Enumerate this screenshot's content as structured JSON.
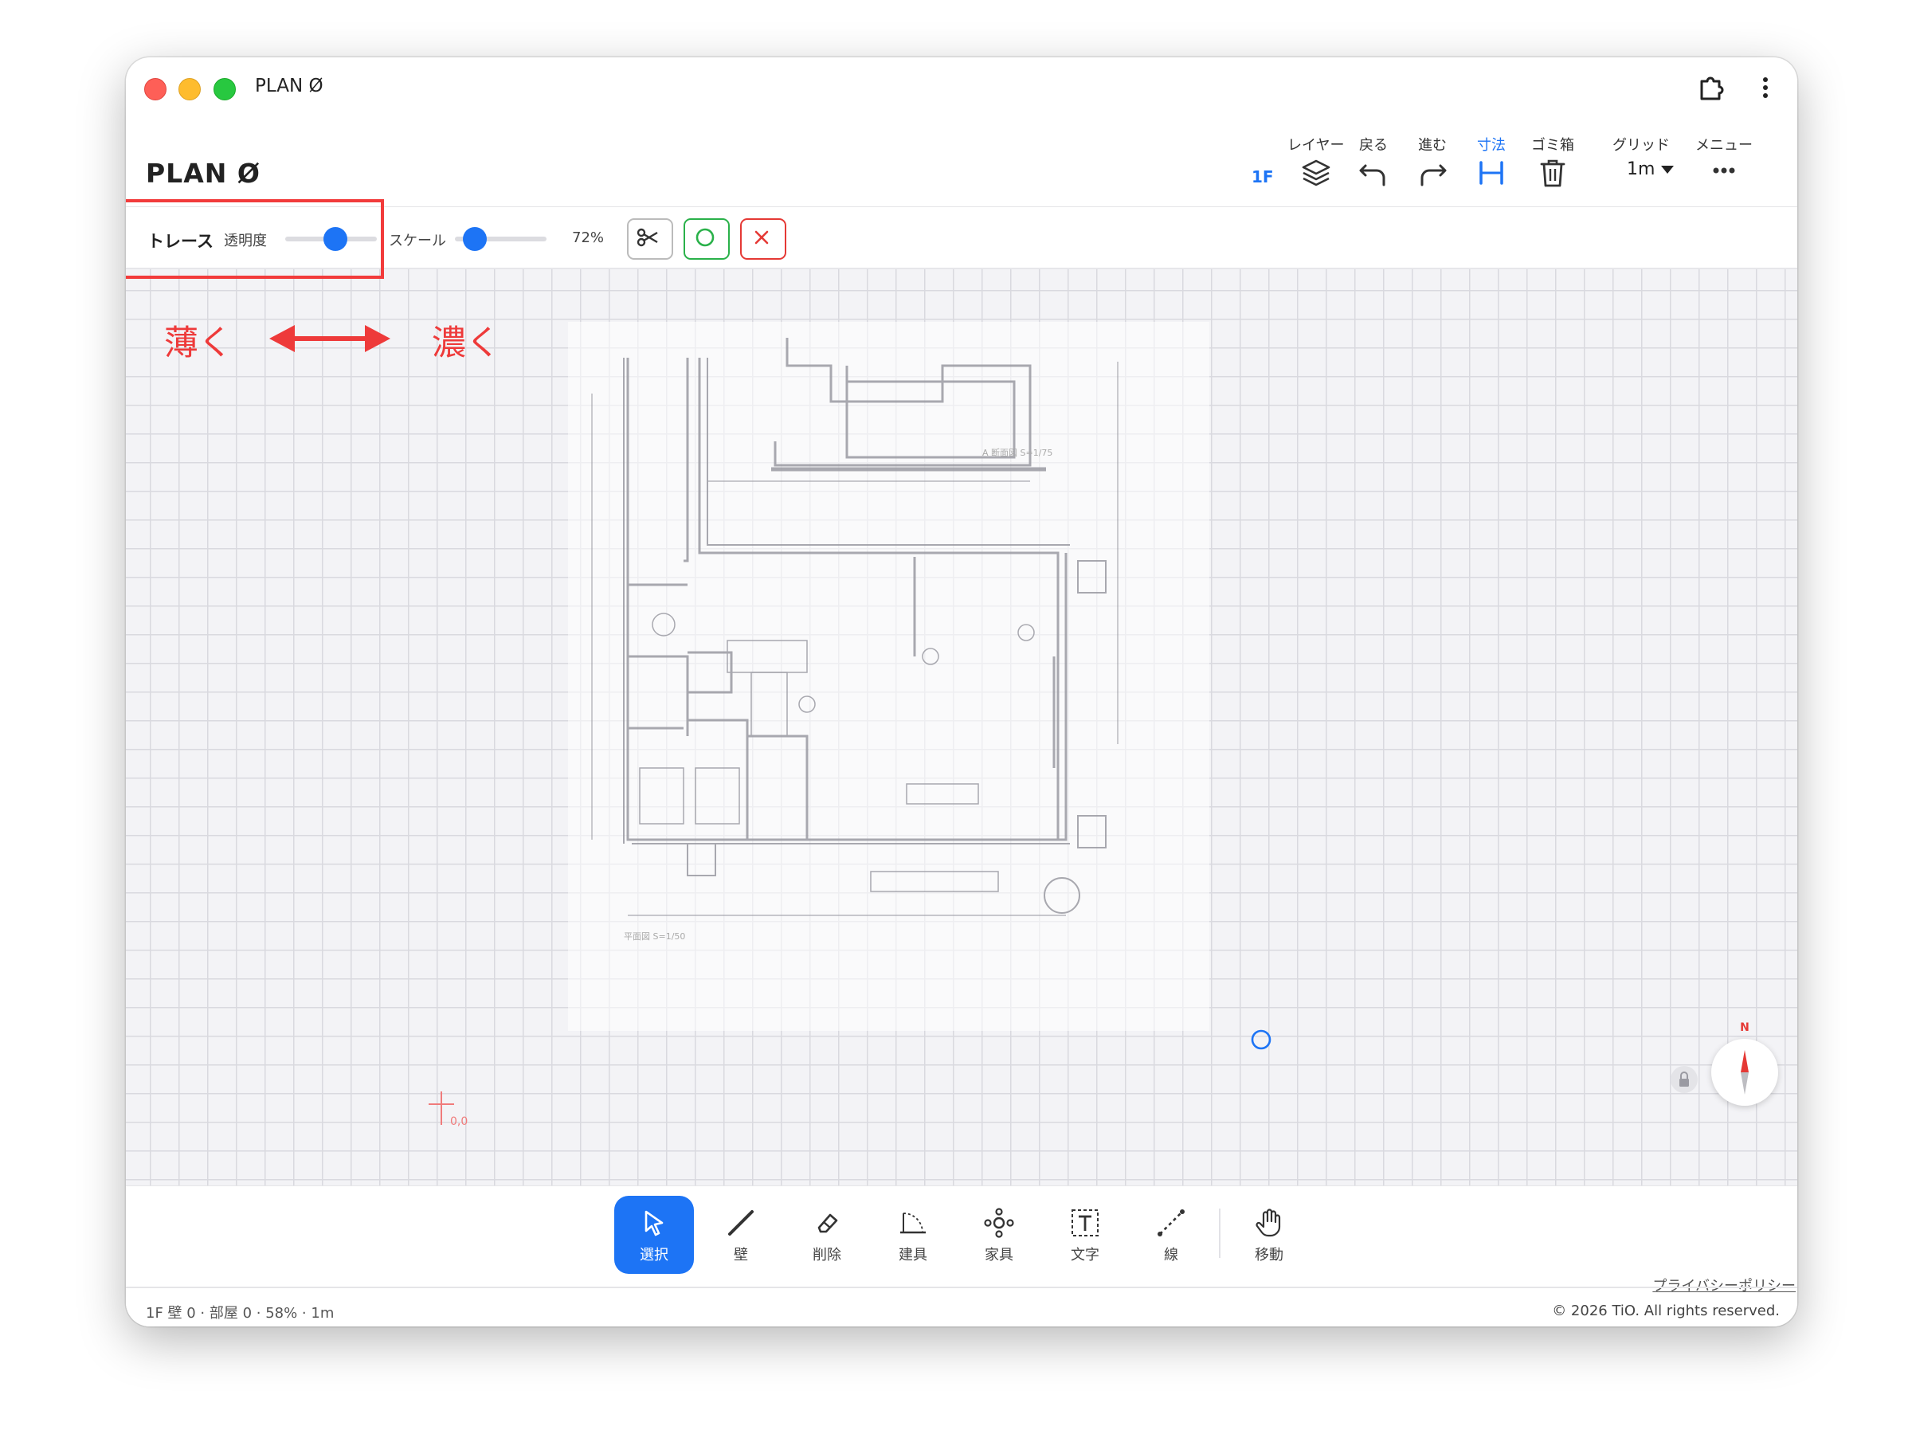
{
  "window": {
    "title": "PLAN Ø"
  },
  "app": {
    "title": "PLAN Ø",
    "floor": "1F"
  },
  "toolbar": {
    "layer_label": "レイヤー",
    "undo_label": "戻る",
    "redo_label": "進む",
    "dimension_label": "寸法",
    "trash_label": "ゴミ箱",
    "grid_label": "グリッド",
    "grid_value": "1m",
    "menu_label": "メニュー"
  },
  "trace": {
    "label": "トレース",
    "opacity_label": "透明度",
    "opacity_value": 0.55,
    "scale_label": "スケール",
    "scale_value": 0.22,
    "scale_percent": "72%"
  },
  "annotations": {
    "lighter": "薄く",
    "darker": "濃く"
  },
  "canvas": {
    "origin_label": "0,0",
    "compass_label": "N"
  },
  "drawing_texts": [
    "A 断面図 S=1/75",
    "平面図 S=1/50"
  ],
  "dock": {
    "select": "選択",
    "wall": "壁",
    "delete": "削除",
    "fixture": "建具",
    "furniture": "家具",
    "text": "文字",
    "line": "線",
    "move": "移動"
  },
  "footer": {
    "status": "1F 壁 0 · 部屋 0 · 58% · 1m",
    "privacy": "プライバシーポリシー",
    "copyright": "© 2026 TiO. All rights reserved."
  },
  "colors": {
    "accent": "#1d74f5",
    "annotation": "#ee3a3a",
    "ok": "#2ab14a",
    "cancel": "#e53935"
  }
}
